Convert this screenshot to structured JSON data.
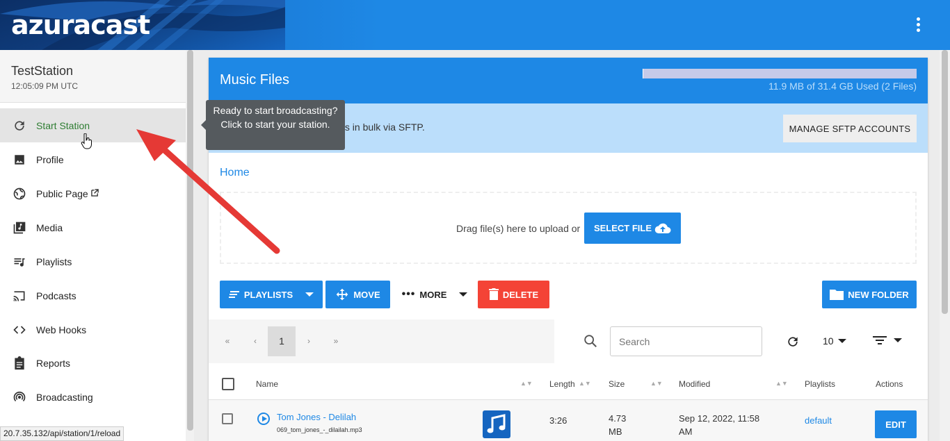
{
  "header": {
    "logo": "azuracast",
    "menu_icon": "kebab-menu-icon"
  },
  "sidebar": {
    "station_name": "TestStation",
    "station_time": "12:05:09 PM UTC",
    "items": [
      {
        "label": "Start Station",
        "icon": "restart-icon"
      },
      {
        "label": "Profile",
        "icon": "image-icon"
      },
      {
        "label": "Public Page",
        "icon": "globe-icon"
      },
      {
        "label": "Media",
        "icon": "music-library-icon"
      },
      {
        "label": "Playlists",
        "icon": "playlist-icon"
      },
      {
        "label": "Podcasts",
        "icon": "cast-icon"
      },
      {
        "label": "Web Hooks",
        "icon": "code-icon"
      },
      {
        "label": "Reports",
        "icon": "clipboard-icon"
      },
      {
        "label": "Broadcasting",
        "icon": "broadcast-icon"
      }
    ]
  },
  "tooltip": {
    "text": "Ready to start broadcasting? Click to start your station."
  },
  "card": {
    "title": "Music Files",
    "quota_text": "11.9 MB of 31.4 GB Used (2 Files)",
    "quota_fraction": 0.0004
  },
  "info": {
    "text": "files in bulk via SFTP.",
    "button": "MANAGE SFTP ACCOUNTS"
  },
  "breadcrumb": "Home",
  "upload": {
    "drop_text": "Drag file(s) here to upload or",
    "select_button": "SELECT FILE"
  },
  "toolbar": {
    "playlists": "PLAYLISTS",
    "move": "MOVE",
    "more": "MORE",
    "delete": "DELETE",
    "new_folder": "NEW FOLDER"
  },
  "pager": {
    "first": "«",
    "prev": "‹",
    "current": "1",
    "next": "›",
    "last": "»"
  },
  "search": {
    "placeholder": "Search"
  },
  "per_page": "10",
  "table": {
    "columns": [
      "Name",
      "Length",
      "Size",
      "Modified",
      "Playlists",
      "Actions"
    ],
    "rows": [
      {
        "title": "Tom Jones - Delilah",
        "file": "069_tom_jones_-_dilailah.mp3",
        "length": "3:26",
        "size_line1": "4.73",
        "size_line2": "MB",
        "modified_line1": "Sep 12, 2022, 11:58",
        "modified_line2": "AM",
        "playlist": "default",
        "action": "EDIT"
      }
    ]
  },
  "statusbar": "20.7.35.132/api/station/1/reload",
  "colors": {
    "primary": "#1e88e5",
    "danger": "#f44336",
    "active_nav": "#2e7d32",
    "arrow": "#e53935"
  }
}
